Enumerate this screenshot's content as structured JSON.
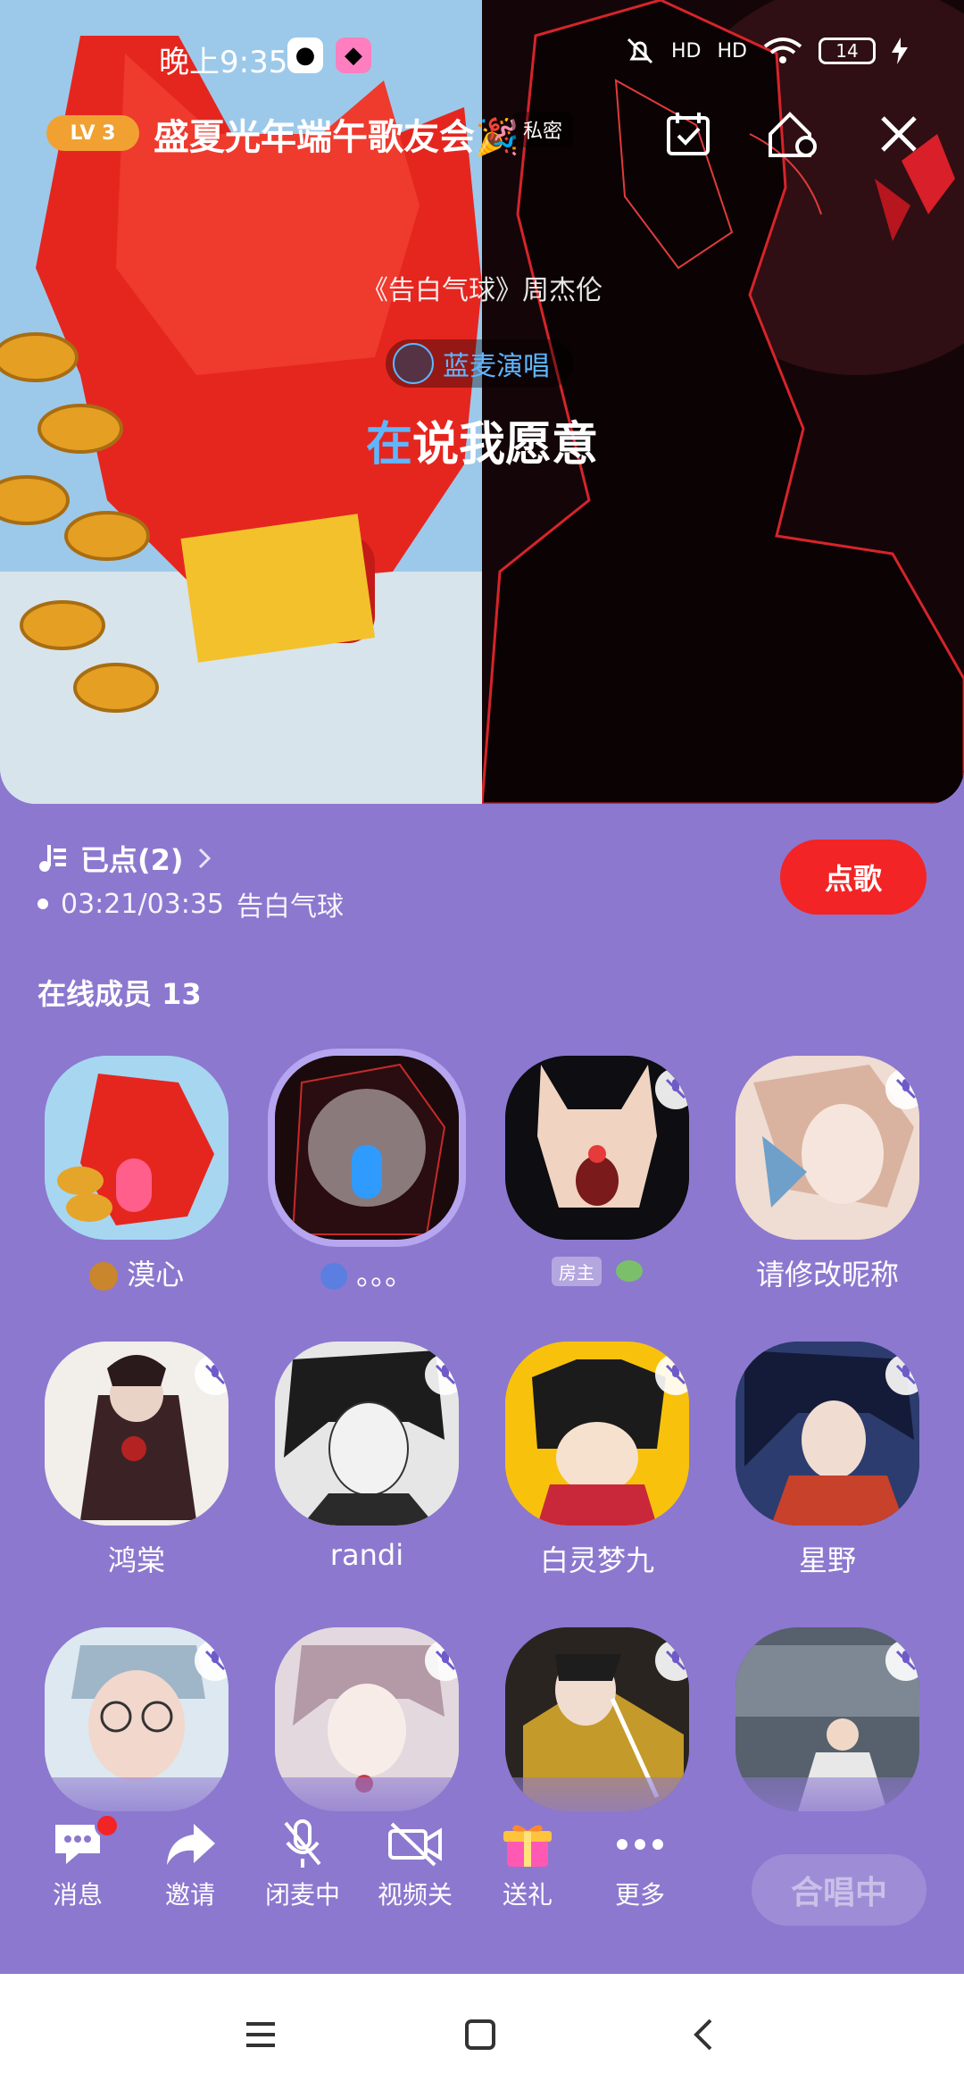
{
  "status_bar": {
    "time": "晚上9:35",
    "signal1": "HD",
    "signal2": "HD",
    "battery": "14"
  },
  "room": {
    "level": "LV 3",
    "title": "盛夏光年端午歌友会🎉",
    "private_tag": "私密"
  },
  "player": {
    "song_info": "《告白气球》周杰伦",
    "singer_label": "蓝麦演唱",
    "lyric_highlight": "在",
    "lyric_rest": "说我愿意"
  },
  "queue": {
    "label": "已点(2)",
    "progress": "03:21/03:35",
    "song": "告白气球",
    "order_button": "点歌"
  },
  "online_title": "在线成员 13",
  "members": [
    {
      "name": "漠心"
    },
    {
      "name": "。。。"
    },
    {
      "host_tag": "房主"
    },
    {
      "name": "请修改昵称"
    },
    {
      "name": "鸿棠"
    },
    {
      "name": "randi"
    },
    {
      "name": "白灵梦九"
    },
    {
      "name": "星野"
    },
    {
      "name": ""
    },
    {
      "name": ""
    },
    {
      "name": ""
    },
    {
      "name": ""
    }
  ],
  "toolbar": {
    "messages": "消息",
    "invite": "邀请",
    "mic": "闭麦中",
    "video": "视频关",
    "gift": "送礼",
    "more": "更多",
    "chorus": "合唱中"
  },
  "colors": {
    "background": "#8c78cf",
    "accent_red": "#f22425",
    "accent_blue": "#5fb6ff"
  }
}
